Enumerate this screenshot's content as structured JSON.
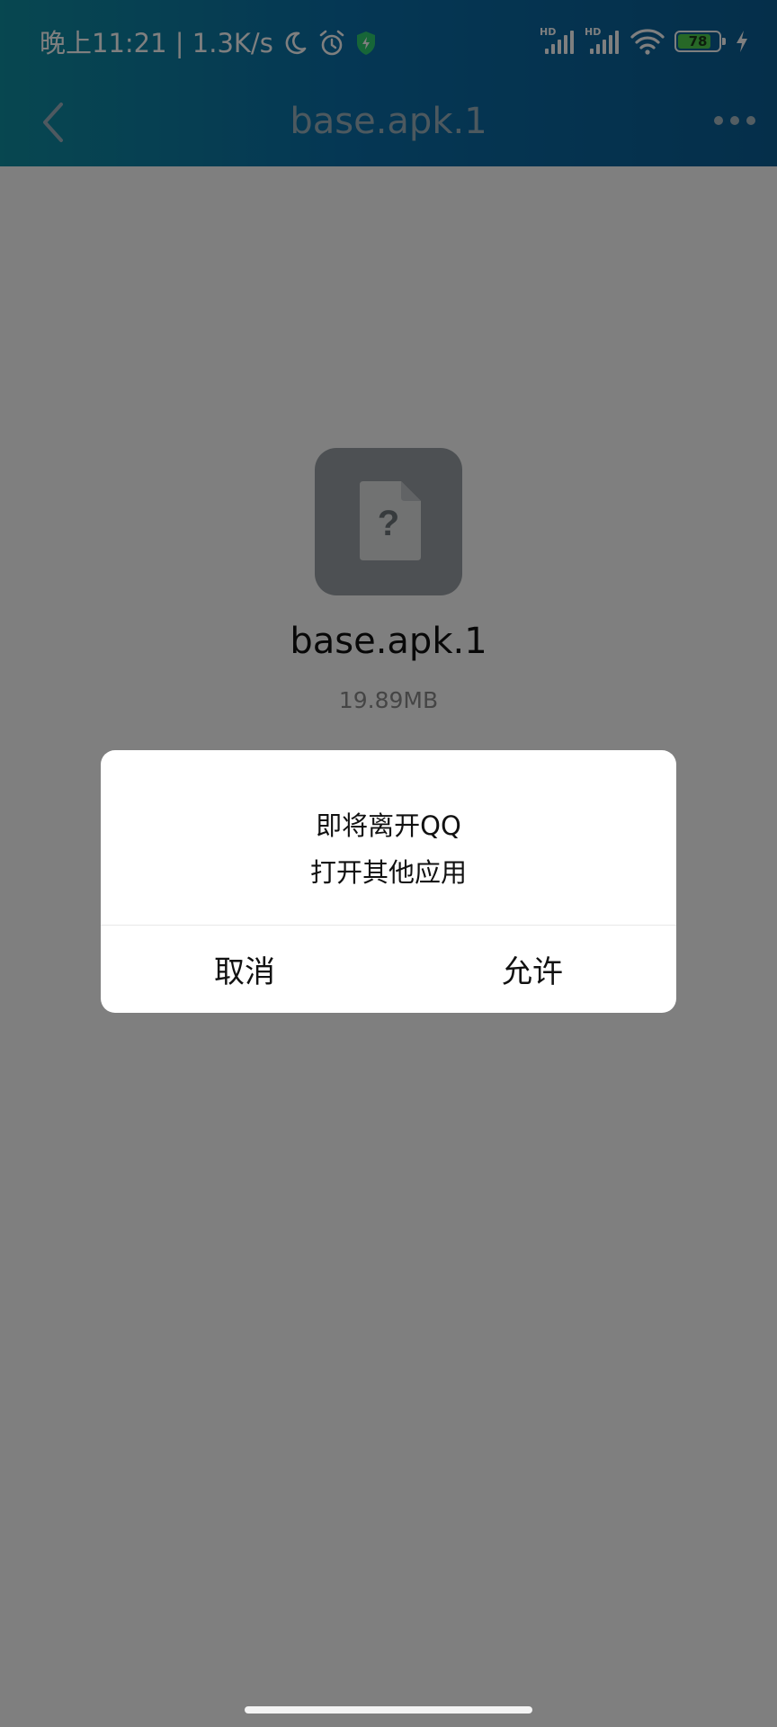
{
  "status_bar": {
    "time_text": "晚上11:21 | 1.3K/s",
    "signal_label_1": "HD",
    "signal_label_2": "HD",
    "battery_level": "78",
    "icons": [
      "moon-icon",
      "alarm-icon",
      "shield-icon",
      "signal-icon",
      "wifi-icon",
      "battery-icon",
      "charging-icon"
    ]
  },
  "header": {
    "title": "base.apk.1",
    "back_icon": "chevron-left-icon",
    "more_icon": "more-icon"
  },
  "file": {
    "name": "base.apk.1",
    "size": "19.89MB",
    "icon": "unknown-file-icon"
  },
  "dialog": {
    "line1": "即将离开QQ",
    "line2": "打开其他应用",
    "cancel_label": "取消",
    "allow_label": "允许"
  },
  "colors": {
    "header_start": "#0f8ea1",
    "header_end": "#0a5e95",
    "battery_fill": "#4fd04f",
    "shield": "#2ecc71"
  }
}
